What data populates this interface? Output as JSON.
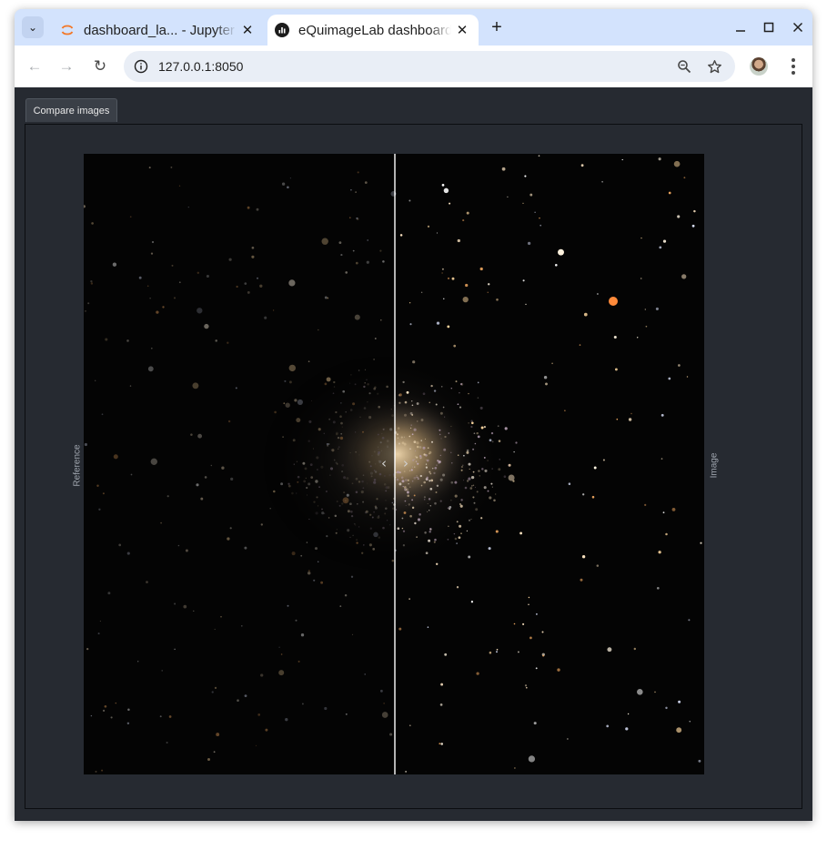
{
  "browser": {
    "tabs": [
      {
        "title": "dashboard_la... - Jupyter",
        "active": false,
        "icon": "jupyter-icon"
      },
      {
        "title": "eQuimageLab dashboard",
        "active": true,
        "icon": "equimagelab-icon"
      }
    ],
    "tab_close_glyph": "✕",
    "new_tab_glyph": "+",
    "window_controls": {
      "minimize": "–",
      "maximize": "☐",
      "close": "✕"
    },
    "url": "127.0.0.1:8050",
    "nav": {
      "back": "←",
      "forward": "→",
      "reload": "↻"
    },
    "accent_color": "#d3e3fd"
  },
  "app": {
    "tabs": [
      {
        "label": "Compare images",
        "active": true
      }
    ],
    "viewer": {
      "left_label": "Reference",
      "right_label": "Image",
      "handle_left_glyph": "‹",
      "handle_right_glyph": "›",
      "background_color": "#262a31"
    }
  }
}
